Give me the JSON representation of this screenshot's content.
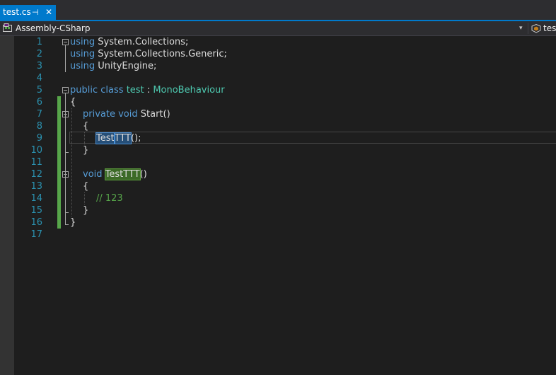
{
  "tab": {
    "filename": "test.cs",
    "pin_glyph": "⊣",
    "close_glyph": "✕"
  },
  "navbar": {
    "project": "Assembly-CSharp",
    "member": "test",
    "dropdown_glyph": "▾"
  },
  "colors": {
    "accent": "#007acc",
    "keyword": "#569cd6",
    "type": "#4ec9b0",
    "comment": "#57a64a",
    "line_number": "#2b91af",
    "change_bar": "#57a64a"
  },
  "editor": {
    "line_numbers": [
      "1",
      "2",
      "3",
      "4",
      "5",
      "6",
      "7",
      "8",
      "9",
      "10",
      "11",
      "12",
      "13",
      "14",
      "15",
      "16",
      "17"
    ],
    "lines": {
      "l1": {
        "kw": "using",
        "rest": " System.Collections;"
      },
      "l2": {
        "kw": "using",
        "rest": " System.Collections.Generic;"
      },
      "l3": {
        "kw": "using",
        "rest": " UnityEngine;"
      },
      "l5": {
        "kw1": "public",
        "kw2": "class",
        "name": "test",
        "colon": " : ",
        "type": "MonoBehaviour"
      },
      "l6": {
        "text": "{"
      },
      "l7": {
        "kw1": "private",
        "kw2": "void",
        "rest": " Start()"
      },
      "l8": {
        "text": "{"
      },
      "l9": {
        "sel": "Test",
        "ref": "TTT",
        "rest": "();"
      },
      "l10": {
        "text": "}"
      },
      "l12": {
        "kw": "void",
        "ref": "TestTTT",
        "rest": "()"
      },
      "l13": {
        "text": "{"
      },
      "l14": {
        "comment": "// 123"
      },
      "l15": {
        "text": "}"
      },
      "l16": {
        "text": "}"
      }
    }
  }
}
